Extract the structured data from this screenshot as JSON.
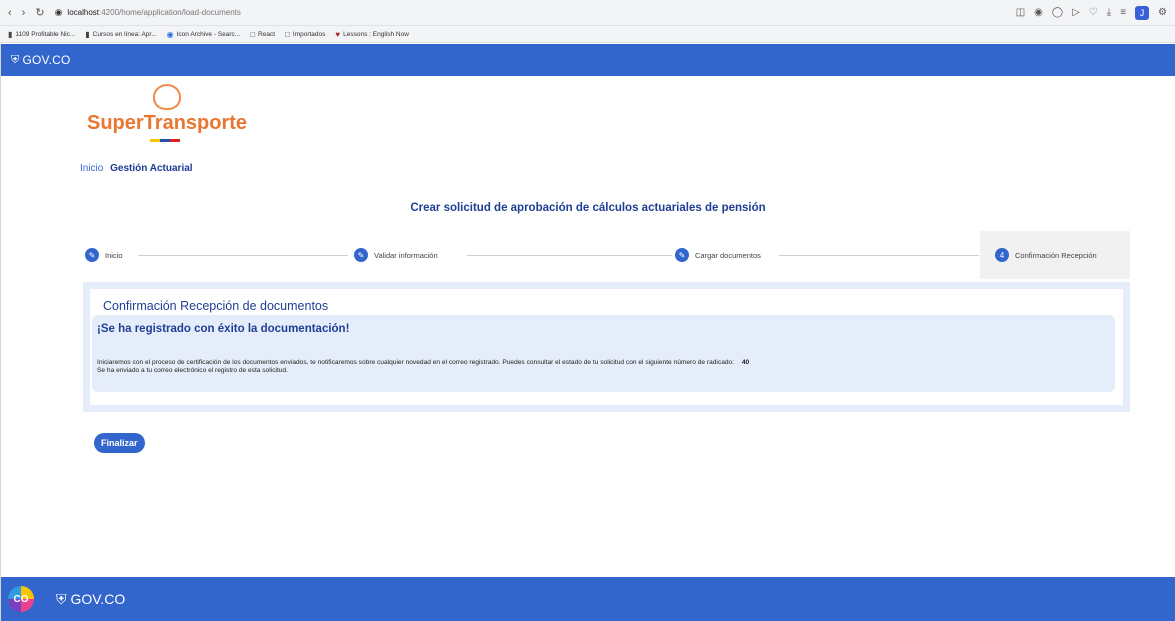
{
  "browser": {
    "url_host": "localhost",
    "url_path": ":4200/home/application/load-documents",
    "profile_initial": "J",
    "bookmarks": [
      {
        "label": "1109 Profitable Nic...",
        "icon": "bookmark-icon"
      },
      {
        "label": "Cursos en línea: Apr...",
        "icon": "bookmark-icon"
      },
      {
        "label": "Icon Archive - Searc...",
        "icon": "globe-icon"
      },
      {
        "label": "React",
        "icon": "folder-icon"
      },
      {
        "label": "Importados",
        "icon": "folder-icon"
      },
      {
        "label": "Lessons : English Now",
        "icon": "heart-icon"
      }
    ]
  },
  "gov_bar": {
    "logo_text": "GOV.CO"
  },
  "brand": {
    "name": "SuperTransporte"
  },
  "breadcrumb": {
    "home": "Inicio",
    "current": "Gestión Actuarial"
  },
  "main": {
    "title": "Crear solicitud de aprobación de cálculos actuariales de pensión"
  },
  "stepper": {
    "steps": [
      {
        "label": "Inicio",
        "icon": "pencil-icon"
      },
      {
        "label": "Validar información",
        "icon": "pencil-icon"
      },
      {
        "label": "Cargar documentos",
        "icon": "pencil-icon"
      },
      {
        "label": "Confirmación Recepción",
        "number": "4"
      }
    ]
  },
  "panel": {
    "title": "Confirmación Recepción de documentos",
    "alert_heading": "¡Se ha registrado con éxito la documentación!",
    "alert_line1": "Iniciaremos con el proceso de certificación de los documentos enviados, te notificaremos sobre cualquier novedad en el correo registrado. Puedes consultar el estado de tu solicitud con el siguiente número de radicado:",
    "radicado": "40",
    "alert_line2": "Se ha enviado a tu correo electrónico el registro de esta solicitud."
  },
  "actions": {
    "finish_label": "Finalizar"
  },
  "footer": {
    "badge_text": "CO",
    "logo_text": "GOV.CO"
  },
  "colors": {
    "gov_blue": "#3366cc",
    "title_blue": "#1f3f94",
    "brand_orange": "#e87732"
  }
}
